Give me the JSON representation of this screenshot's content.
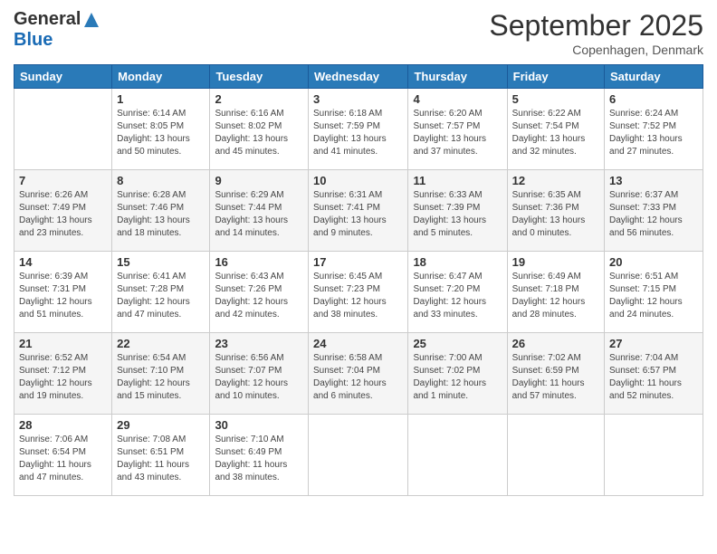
{
  "logo": {
    "general": "General",
    "blue": "Blue"
  },
  "title": "September 2025",
  "subtitle": "Copenhagen, Denmark",
  "days_of_week": [
    "Sunday",
    "Monday",
    "Tuesday",
    "Wednesday",
    "Thursday",
    "Friday",
    "Saturday"
  ],
  "weeks": [
    [
      {
        "day": "",
        "info": ""
      },
      {
        "day": "1",
        "info": "Sunrise: 6:14 AM\nSunset: 8:05 PM\nDaylight: 13 hours\nand 50 minutes."
      },
      {
        "day": "2",
        "info": "Sunrise: 6:16 AM\nSunset: 8:02 PM\nDaylight: 13 hours\nand 45 minutes."
      },
      {
        "day": "3",
        "info": "Sunrise: 6:18 AM\nSunset: 7:59 PM\nDaylight: 13 hours\nand 41 minutes."
      },
      {
        "day": "4",
        "info": "Sunrise: 6:20 AM\nSunset: 7:57 PM\nDaylight: 13 hours\nand 37 minutes."
      },
      {
        "day": "5",
        "info": "Sunrise: 6:22 AM\nSunset: 7:54 PM\nDaylight: 13 hours\nand 32 minutes."
      },
      {
        "day": "6",
        "info": "Sunrise: 6:24 AM\nSunset: 7:52 PM\nDaylight: 13 hours\nand 27 minutes."
      }
    ],
    [
      {
        "day": "7",
        "info": "Sunrise: 6:26 AM\nSunset: 7:49 PM\nDaylight: 13 hours\nand 23 minutes."
      },
      {
        "day": "8",
        "info": "Sunrise: 6:28 AM\nSunset: 7:46 PM\nDaylight: 13 hours\nand 18 minutes."
      },
      {
        "day": "9",
        "info": "Sunrise: 6:29 AM\nSunset: 7:44 PM\nDaylight: 13 hours\nand 14 minutes."
      },
      {
        "day": "10",
        "info": "Sunrise: 6:31 AM\nSunset: 7:41 PM\nDaylight: 13 hours\nand 9 minutes."
      },
      {
        "day": "11",
        "info": "Sunrise: 6:33 AM\nSunset: 7:39 PM\nDaylight: 13 hours\nand 5 minutes."
      },
      {
        "day": "12",
        "info": "Sunrise: 6:35 AM\nSunset: 7:36 PM\nDaylight: 13 hours\nand 0 minutes."
      },
      {
        "day": "13",
        "info": "Sunrise: 6:37 AM\nSunset: 7:33 PM\nDaylight: 12 hours\nand 56 minutes."
      }
    ],
    [
      {
        "day": "14",
        "info": "Sunrise: 6:39 AM\nSunset: 7:31 PM\nDaylight: 12 hours\nand 51 minutes."
      },
      {
        "day": "15",
        "info": "Sunrise: 6:41 AM\nSunset: 7:28 PM\nDaylight: 12 hours\nand 47 minutes."
      },
      {
        "day": "16",
        "info": "Sunrise: 6:43 AM\nSunset: 7:26 PM\nDaylight: 12 hours\nand 42 minutes."
      },
      {
        "day": "17",
        "info": "Sunrise: 6:45 AM\nSunset: 7:23 PM\nDaylight: 12 hours\nand 38 minutes."
      },
      {
        "day": "18",
        "info": "Sunrise: 6:47 AM\nSunset: 7:20 PM\nDaylight: 12 hours\nand 33 minutes."
      },
      {
        "day": "19",
        "info": "Sunrise: 6:49 AM\nSunset: 7:18 PM\nDaylight: 12 hours\nand 28 minutes."
      },
      {
        "day": "20",
        "info": "Sunrise: 6:51 AM\nSunset: 7:15 PM\nDaylight: 12 hours\nand 24 minutes."
      }
    ],
    [
      {
        "day": "21",
        "info": "Sunrise: 6:52 AM\nSunset: 7:12 PM\nDaylight: 12 hours\nand 19 minutes."
      },
      {
        "day": "22",
        "info": "Sunrise: 6:54 AM\nSunset: 7:10 PM\nDaylight: 12 hours\nand 15 minutes."
      },
      {
        "day": "23",
        "info": "Sunrise: 6:56 AM\nSunset: 7:07 PM\nDaylight: 12 hours\nand 10 minutes."
      },
      {
        "day": "24",
        "info": "Sunrise: 6:58 AM\nSunset: 7:04 PM\nDaylight: 12 hours\nand 6 minutes."
      },
      {
        "day": "25",
        "info": "Sunrise: 7:00 AM\nSunset: 7:02 PM\nDaylight: 12 hours\nand 1 minute."
      },
      {
        "day": "26",
        "info": "Sunrise: 7:02 AM\nSunset: 6:59 PM\nDaylight: 11 hours\nand 57 minutes."
      },
      {
        "day": "27",
        "info": "Sunrise: 7:04 AM\nSunset: 6:57 PM\nDaylight: 11 hours\nand 52 minutes."
      }
    ],
    [
      {
        "day": "28",
        "info": "Sunrise: 7:06 AM\nSunset: 6:54 PM\nDaylight: 11 hours\nand 47 minutes."
      },
      {
        "day": "29",
        "info": "Sunrise: 7:08 AM\nSunset: 6:51 PM\nDaylight: 11 hours\nand 43 minutes."
      },
      {
        "day": "30",
        "info": "Sunrise: 7:10 AM\nSunset: 6:49 PM\nDaylight: 11 hours\nand 38 minutes."
      },
      {
        "day": "",
        "info": ""
      },
      {
        "day": "",
        "info": ""
      },
      {
        "day": "",
        "info": ""
      },
      {
        "day": "",
        "info": ""
      }
    ]
  ]
}
